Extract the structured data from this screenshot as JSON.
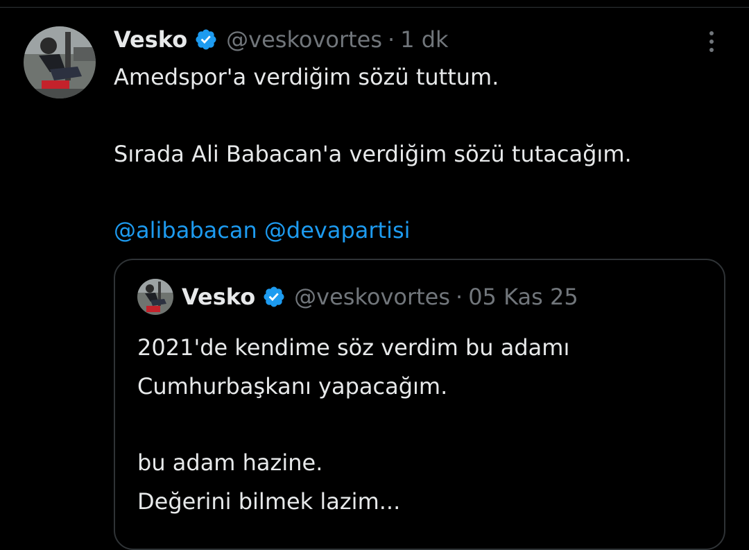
{
  "tweet": {
    "author": {
      "name": "Vesko",
      "handle": "@veskovortes",
      "verified_icon": "verified-badge-icon",
      "avatar_icon": "profile-photo"
    },
    "separator": "·",
    "time": "1 dk",
    "more_icon": "more-options-icon",
    "text_lines": [
      "Amedspor'a verdiğim sözü tuttum.",
      "Sırada Ali Babacan'a verdiğim sözü tutacağım."
    ],
    "mentions": [
      "@alibabacan",
      "@devapartisi"
    ]
  },
  "quote": {
    "author": {
      "name": "Vesko",
      "handle": "@veskovortes"
    },
    "separator": "·",
    "date": "05 Kas 25",
    "text_lines": [
      "2021'de kendime söz verdim bu adamı",
      "Cumhurbaşkanı yapacağım.",
      "bu adam hazine.",
      "Değerini bilmek lazim..."
    ]
  },
  "colors": {
    "background": "#000000",
    "text": "#e7e9ea",
    "muted": "#71767b",
    "link": "#1d9bf0",
    "border": "#2f3336",
    "verified": "#1d9bf0"
  }
}
